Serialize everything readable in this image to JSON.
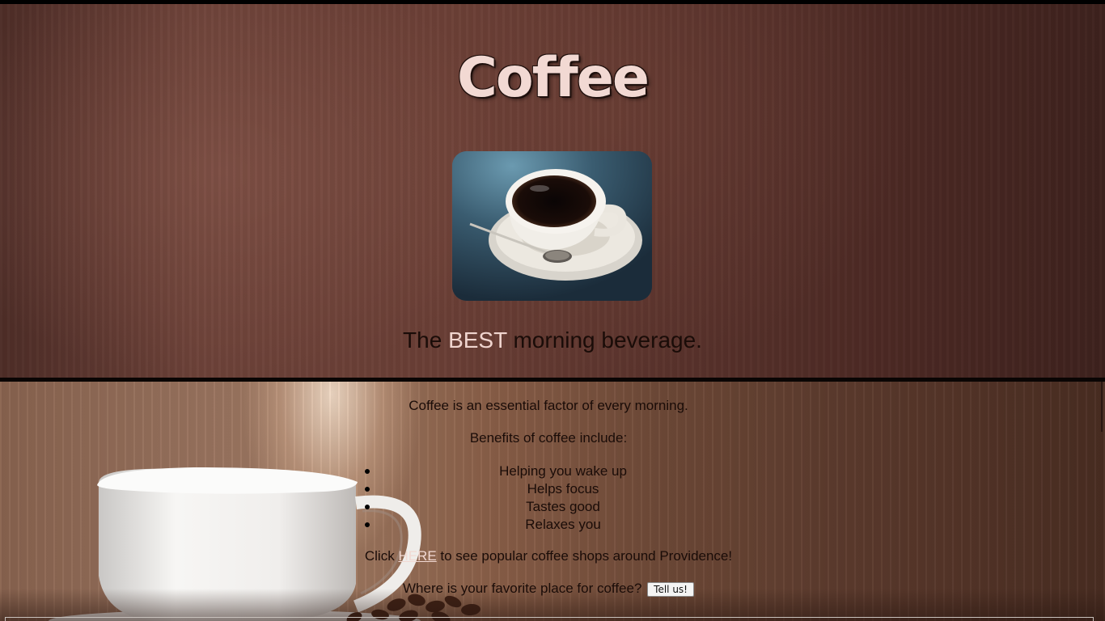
{
  "header": {
    "title": "Coffee",
    "tagline_before": "The ",
    "tagline_highlight": "BEST",
    "tagline_after": " morning beverage."
  },
  "content": {
    "intro": "Coffee is an essential factor of every morning.",
    "benefits_heading": "Benefits of coffee include:",
    "benefits": [
      "Helping you wake up",
      "Helps focus",
      "Tastes good",
      "Relaxes you"
    ],
    "click_prefix": "Click ",
    "link_label": "HERE",
    "click_suffix": " to see popular coffee shops around Providence!",
    "question": "Where is your favorite place for coffee?",
    "tell_button_label": "Tell us!"
  },
  "images": {
    "header_photo": "coffee-cup-on-saucer-photo",
    "background_photo": "white-coffee-cup-and-beans-photo"
  },
  "colors": {
    "title": "#f2d9d3",
    "highlight": "#f0d5cf",
    "text": "#1a0c08",
    "link": "#f2d9d3"
  }
}
